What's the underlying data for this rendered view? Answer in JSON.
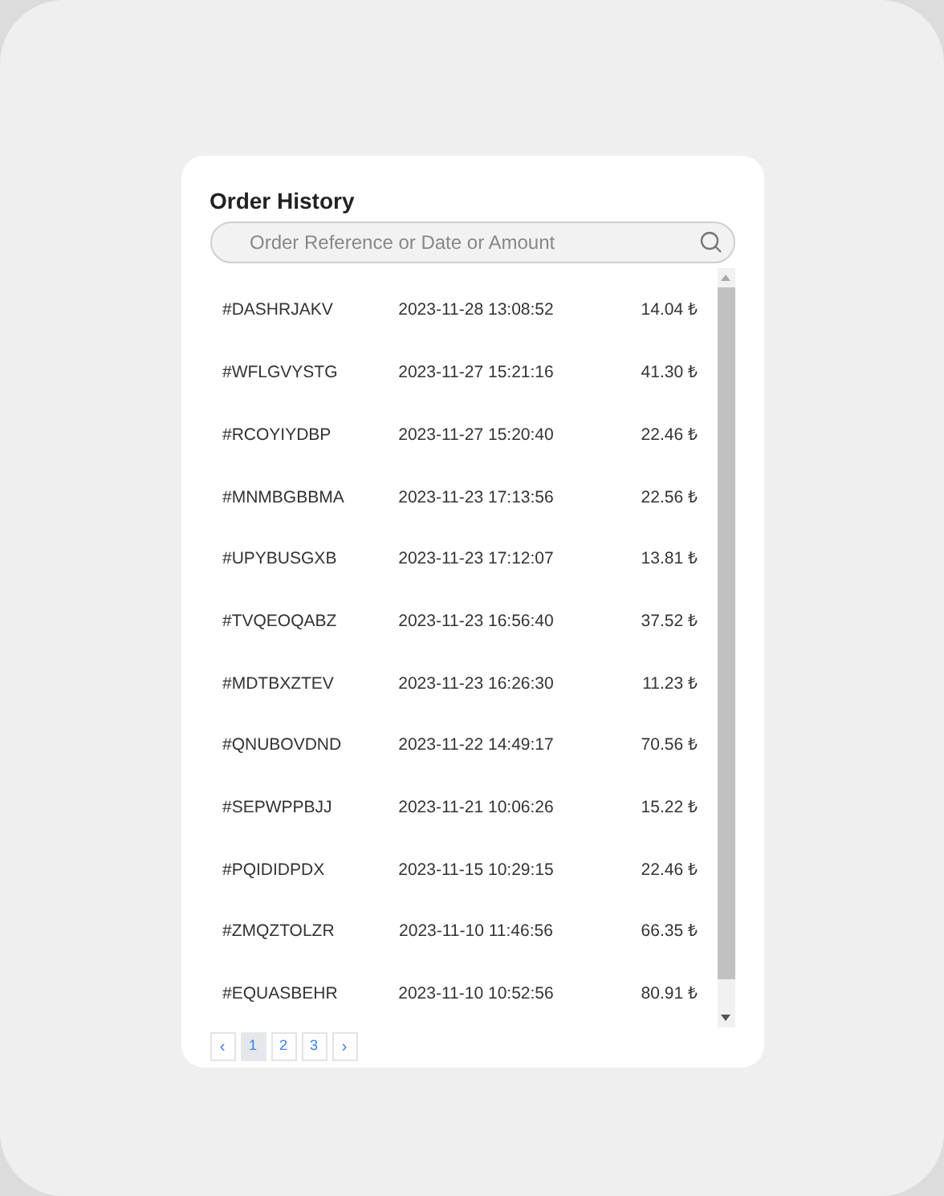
{
  "title": "Order History",
  "search": {
    "placeholder": "Order Reference or Date or Amount"
  },
  "orders": [
    {
      "reference": "#DASHRJAKV",
      "date": "2023-11-28 13:08:52",
      "amount": "14.04 ₺"
    },
    {
      "reference": "#WFLGVYSTG",
      "date": "2023-11-27 15:21:16",
      "amount": "41.30 ₺"
    },
    {
      "reference": "#RCOYIYDBP",
      "date": "2023-11-27 15:20:40",
      "amount": "22.46 ₺"
    },
    {
      "reference": "#MNMBGBBMA",
      "date": "2023-11-23 17:13:56",
      "amount": "22.56 ₺"
    },
    {
      "reference": "#UPYBUSGXB",
      "date": "2023-11-23 17:12:07",
      "amount": "13.81 ₺"
    },
    {
      "reference": "#TVQEOQABZ",
      "date": "2023-11-23 16:56:40",
      "amount": "37.52 ₺"
    },
    {
      "reference": "#MDTBXZTEV",
      "date": "2023-11-23 16:26:30",
      "amount": "11.23 ₺"
    },
    {
      "reference": "#QNUBOVDND",
      "date": "2023-11-22 14:49:17",
      "amount": "70.56 ₺"
    },
    {
      "reference": "#SEPWPPBJJ",
      "date": "2023-11-21 10:06:26",
      "amount": "15.22 ₺"
    },
    {
      "reference": "#PQIDIDPDX",
      "date": "2023-11-15 10:29:15",
      "amount": "22.46 ₺"
    },
    {
      "reference": "#ZMQZTOLZR",
      "date": "2023-11-10 11:46:56",
      "amount": "66.35 ₺"
    },
    {
      "reference": "#EQUASBEHR",
      "date": "2023-11-10 10:52:56",
      "amount": "80.91 ₺"
    }
  ],
  "pagination": {
    "previous": "‹",
    "next": "›",
    "pages": [
      {
        "label": "1",
        "selected": true
      },
      {
        "label": "2",
        "selected": false
      },
      {
        "label": "3",
        "selected": false
      }
    ]
  }
}
